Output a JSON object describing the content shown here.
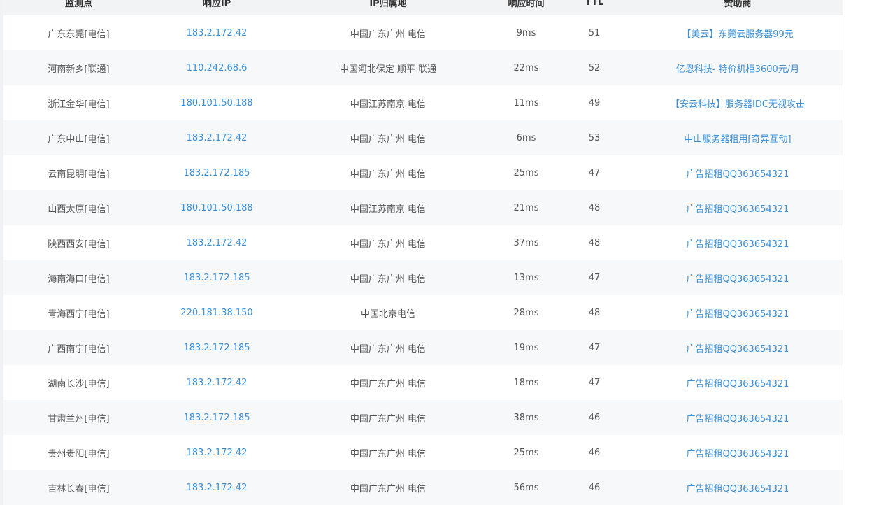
{
  "table": {
    "headers": [
      "监测点",
      "响应IP",
      "IP归属地",
      "响应时间",
      "TTL",
      "赞助商"
    ],
    "rows": [
      {
        "node": "广东东莞[电信]",
        "ip": "183.2.172.42",
        "location": "中国广东广州 电信",
        "time": "9ms",
        "ttl": "51",
        "sponsor": "【美云】东莞云服务器99元"
      },
      {
        "node": "河南新乡[联通]",
        "ip": "110.242.68.6",
        "location": "中国河北保定 顺平 联通",
        "time": "22ms",
        "ttl": "52",
        "sponsor": "亿恩科技- 特价机柜3600元/月"
      },
      {
        "node": "浙江金华[电信]",
        "ip": "180.101.50.188",
        "location": "中国江苏南京 电信",
        "time": "11ms",
        "ttl": "49",
        "sponsor": "【安云科技】服务器IDC无视攻击"
      },
      {
        "node": "广东中山[电信]",
        "ip": "183.2.172.42",
        "location": "中国广东广州 电信",
        "time": "6ms",
        "ttl": "53",
        "sponsor": "中山服务器租用[奇异互动]"
      },
      {
        "node": "云南昆明[电信]",
        "ip": "183.2.172.185",
        "location": "中国广东广州 电信",
        "time": "25ms",
        "ttl": "47",
        "sponsor": "广告招租QQ363654321"
      },
      {
        "node": "山西太原[电信]",
        "ip": "180.101.50.188",
        "location": "中国江苏南京 电信",
        "time": "21ms",
        "ttl": "48",
        "sponsor": "广告招租QQ363654321"
      },
      {
        "node": "陕西西安[电信]",
        "ip": "183.2.172.42",
        "location": "中国广东广州 电信",
        "time": "37ms",
        "ttl": "48",
        "sponsor": "广告招租QQ363654321"
      },
      {
        "node": "海南海口[电信]",
        "ip": "183.2.172.185",
        "location": "中国广东广州 电信",
        "time": "13ms",
        "ttl": "47",
        "sponsor": "广告招租QQ363654321"
      },
      {
        "node": "青海西宁[电信]",
        "ip": "220.181.38.150",
        "location": "中国北京电信",
        "time": "28ms",
        "ttl": "48",
        "sponsor": "广告招租QQ363654321"
      },
      {
        "node": "广西南宁[电信]",
        "ip": "183.2.172.185",
        "location": "中国广东广州 电信",
        "time": "19ms",
        "ttl": "47",
        "sponsor": "广告招租QQ363654321"
      },
      {
        "node": "湖南长沙[电信]",
        "ip": "183.2.172.42",
        "location": "中国广东广州 电信",
        "time": "18ms",
        "ttl": "47",
        "sponsor": "广告招租QQ363654321"
      },
      {
        "node": "甘肃兰州[电信]",
        "ip": "183.2.172.185",
        "location": "中国广东广州 电信",
        "time": "38ms",
        "ttl": "46",
        "sponsor": "广告招租QQ363654321"
      },
      {
        "node": "贵州贵阳[电信]",
        "ip": "183.2.172.42",
        "location": "中国广东广州 电信",
        "time": "25ms",
        "ttl": "46",
        "sponsor": "广告招租QQ363654321"
      },
      {
        "node": "吉林长春[电信]",
        "ip": "183.2.172.42",
        "location": "中国广东广州 电信",
        "time": "56ms",
        "ttl": "46",
        "sponsor": "广告招租QQ363654321"
      }
    ]
  }
}
